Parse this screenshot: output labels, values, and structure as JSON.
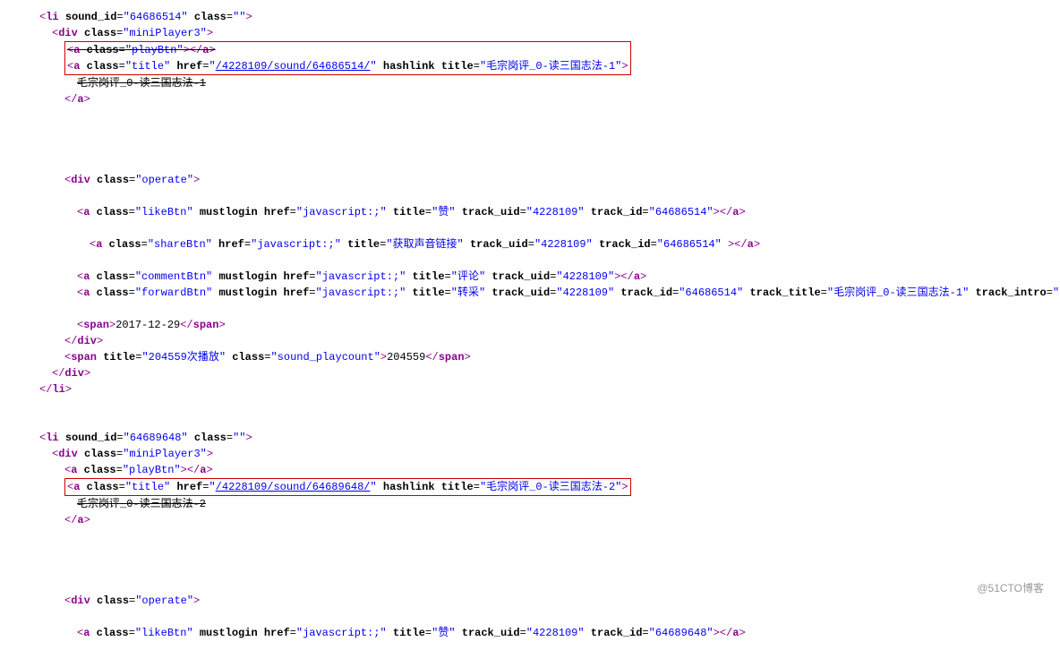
{
  "items": [
    {
      "sound_id": "64686514",
      "title_href": "/4228109/sound/64686514/",
      "title_title": "毛宗岗评_0-读三国志法-1",
      "title_text": "毛宗岗评_0-读三国志法-1",
      "like": {
        "href": "javascript:;",
        "title": "赞",
        "track_uid": "4228109",
        "track_id": "64686514"
      },
      "share": {
        "href": "javascript:;",
        "title": "获取声音链接",
        "track_uid": "4228109",
        "track_id": "64686514"
      },
      "comment": {
        "href": "javascript:;",
        "title": "评论",
        "track_uid": "4228109"
      },
      "forward": {
        "href": "javascript:;",
        "title": "转采",
        "track_uid": "4228109",
        "track_id": "64686514",
        "track_title": "毛宗岗评_0-读三国志法-1",
        "track_intro": ""
      },
      "date": "2017-12-29",
      "playcount_title": "204559次播放",
      "playcount_text": "204559"
    },
    {
      "sound_id": "64689648",
      "title_href": "/4228109/sound/64689648/",
      "title_title": "毛宗岗评_0-读三国志法-2",
      "title_text": "毛宗岗评_0-读三国志法-2",
      "like": {
        "href": "javascript:;",
        "title": "赞",
        "track_uid": "4228109",
        "track_id": "64689648"
      }
    }
  ],
  "watermark": "@51CTO博客"
}
